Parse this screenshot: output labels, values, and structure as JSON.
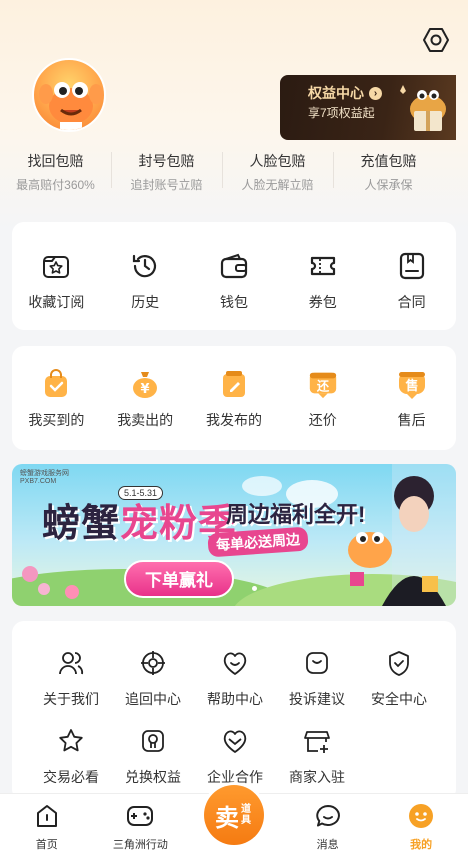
{
  "header": {
    "benefit_title": "权益中心",
    "benefit_sub": "享7项权益起"
  },
  "guarantees": [
    {
      "title": "找回包赔",
      "sub": "最高赔付360%"
    },
    {
      "title": "封号包赔",
      "sub": "追封账号立赔"
    },
    {
      "title": "人脸包赔",
      "sub": "人脸无解立赔"
    },
    {
      "title": "充值包赔",
      "sub": "人保承保"
    }
  ],
  "quick": [
    {
      "label": "收藏订阅",
      "icon": "star-folder-icon"
    },
    {
      "label": "历史",
      "icon": "history-icon"
    },
    {
      "label": "钱包",
      "icon": "wallet-icon"
    },
    {
      "label": "券包",
      "icon": "coupon-icon"
    },
    {
      "label": "合同",
      "icon": "contract-icon"
    }
  ],
  "orders": [
    {
      "label": "我买到的",
      "icon": "bought-bag-icon"
    },
    {
      "label": "我卖出的",
      "icon": "sold-money-bag-icon"
    },
    {
      "label": "我发布的",
      "icon": "published-icon"
    },
    {
      "label": "还价",
      "icon": "bargain-icon",
      "glyph": "还"
    },
    {
      "label": "售后",
      "icon": "after-sale-icon",
      "glyph": "售"
    }
  ],
  "banner": {
    "logo": "螃蟹游戏服务网\nPXB7.COM",
    "date": "5.1-5.31",
    "main_a": "螃蟹",
    "main_b": "宠粉季",
    "right": "周边福利全开!",
    "sub": "每单必送周边",
    "button": "下单赢礼"
  },
  "services": [
    {
      "label": "关于我们",
      "icon": "people-icon"
    },
    {
      "label": "追回中心",
      "icon": "target-icon"
    },
    {
      "label": "帮助中心",
      "icon": "smile-heart-icon"
    },
    {
      "label": "投诉建议",
      "icon": "complaint-icon"
    },
    {
      "label": "安全中心",
      "icon": "shield-check-icon"
    },
    {
      "label": "交易必看",
      "icon": "star-icon"
    },
    {
      "label": "兑换权益",
      "icon": "redeem-icon"
    },
    {
      "label": "企业合作",
      "icon": "handshake-heart-icon"
    },
    {
      "label": "商家入驻",
      "icon": "merchant-icon"
    }
  ],
  "tabbar": {
    "home": "首页",
    "game": "三角洲行动",
    "sell_main": "卖",
    "sell_side": "道具",
    "messages": "消息",
    "mine": "我的"
  },
  "colors": {
    "accent": "#f7a125",
    "sell": "#f57b12",
    "banner_pink": "#e8468f"
  }
}
